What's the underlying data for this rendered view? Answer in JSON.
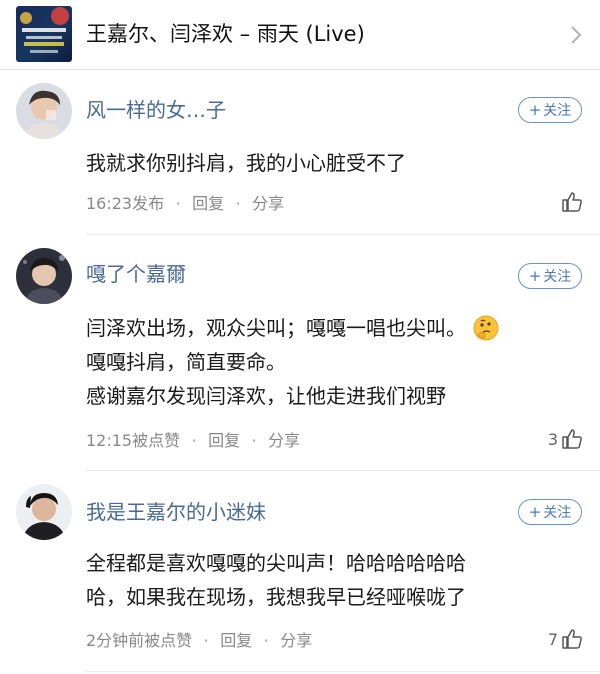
{
  "song": {
    "title": "王嘉尔、闫泽欢 – 雨天 (Live)",
    "cover_icon": "album-cover-image"
  },
  "follow_label": "关注",
  "reply_label": "回复",
  "share_label": "分享",
  "comments": [
    {
      "username": "风一样的女…子",
      "lines": [
        "我就求你别抖肩，我的小心脏受不了"
      ],
      "time": "16:23发布",
      "likes": ""
    },
    {
      "username": "嘎了个嘉爾",
      "lines": [
        "闫泽欢出场，观众尖叫；嘎嘎一唱也尖叫。",
        "嘎嘎抖肩，简直要命。",
        "感谢嘉尔发现闫泽欢，让他走进我们视野"
      ],
      "emoji": "thinking-face-icon",
      "time": "12:15被点赞",
      "likes": "3"
    },
    {
      "username": "我是王嘉尔的小迷妹",
      "lines": [
        "全程都是喜欢嘎嘎的尖叫声！哈哈哈哈哈哈",
        "哈，如果我在现场，我想我早已经哑喉咙了"
      ],
      "time": "2分钟前被点赞",
      "likes": "7"
    }
  ],
  "colors": {
    "username": "#4a6a93",
    "follow": "#4a79b8",
    "meta": "#888888"
  }
}
